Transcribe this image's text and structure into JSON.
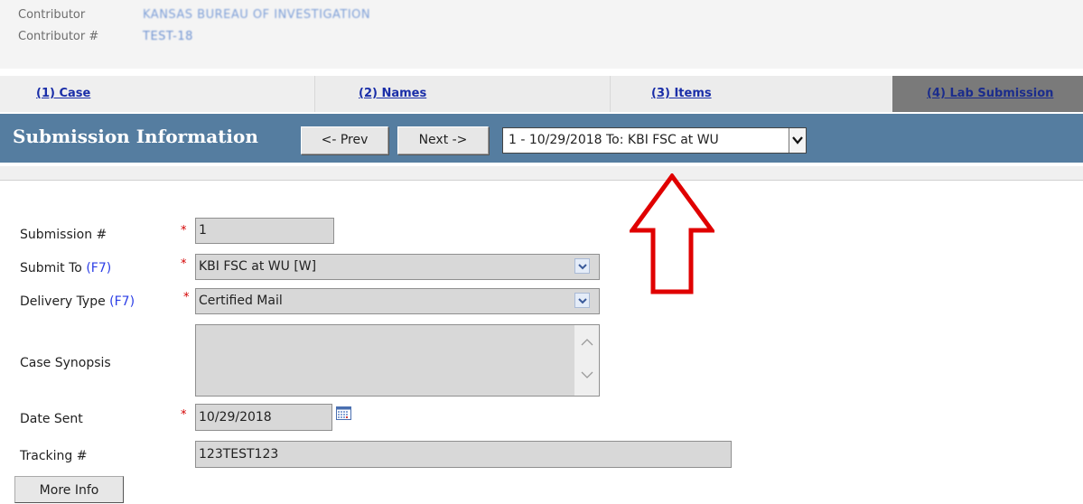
{
  "contributor": {
    "label": "Contributor",
    "value": "KANSAS BUREAU OF INVESTIGATION",
    "number_label": "Contributor #",
    "number_value": "TEST-18"
  },
  "tabs": [
    {
      "label": "(1) Case"
    },
    {
      "label": "(2) Names"
    },
    {
      "label": "(3) Items"
    },
    {
      "label": "(4) Lab Submission"
    }
  ],
  "titlebar": {
    "title": "Submission Information",
    "prev_label": "<- Prev",
    "next_label": "Next ->",
    "submission_select": "1 - 10/29/2018 To: KBI FSC at WU"
  },
  "form": {
    "submission_no": {
      "label": "Submission #",
      "value": "1"
    },
    "submit_to": {
      "label": "Submit To",
      "hotkey": "(F7)",
      "value": "KBI FSC at WU [W]"
    },
    "delivery_type": {
      "label": "Delivery Type",
      "hotkey": "(F7)",
      "value": "Certified Mail"
    },
    "case_synopsis": {
      "label": "Case Synopsis",
      "value": ""
    },
    "date_sent": {
      "label": "Date Sent",
      "value": "10/29/2018"
    },
    "tracking": {
      "label": "Tracking #",
      "value": "123TEST123"
    },
    "required_marker": "*"
  },
  "more_info_label": "More Info",
  "colors": {
    "titlebar_bg": "#557da0",
    "tab_link": "#1a2ea8",
    "required": "#d40000",
    "hotkey": "#2b3ee6",
    "annotation_arrow": "#e00000"
  },
  "icons": [
    "chevron-down-icon",
    "scroll-up-icon",
    "scroll-down-icon",
    "calendar-icon",
    "annotation-arrow"
  ]
}
